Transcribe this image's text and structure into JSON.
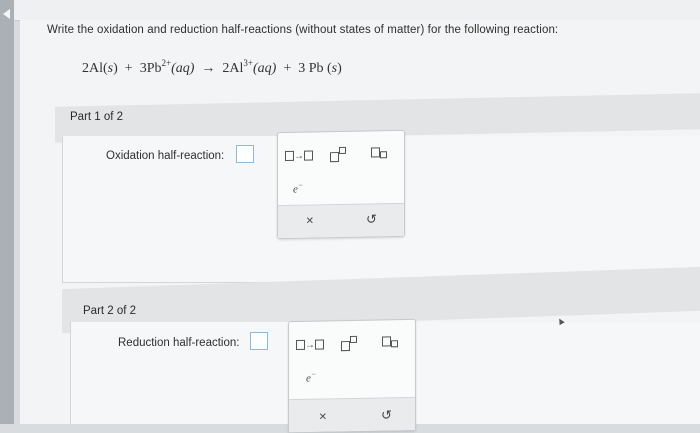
{
  "question": "Write the oxidation and reduction half-reactions (without states of matter) for the following reaction:",
  "equation": {
    "lhs1": "2Al(",
    "lhs1_state": "s",
    "lhs1_close": ")",
    "plus1": "+",
    "lhs2": "3Pb",
    "lhs2_charge": "2+",
    "lhs2_state": "(aq)",
    "arrow": "→",
    "rhs1": "2Al",
    "rhs1_charge": "3+",
    "rhs1_state": "(aq)",
    "plus2": "+",
    "rhs2": "3 Pb (",
    "rhs2_state": "s",
    "rhs2_close": ")"
  },
  "part1": {
    "label": "Part 1 of 2",
    "field_label": "Oxidation half-reaction:"
  },
  "part2": {
    "label": "Part 2 of 2",
    "field_label": "Reduction half-reaction:"
  },
  "palette": {
    "arrow_tool": "→",
    "electron": "e",
    "electron_charge": "−",
    "clear": "×",
    "undo": "↺"
  }
}
